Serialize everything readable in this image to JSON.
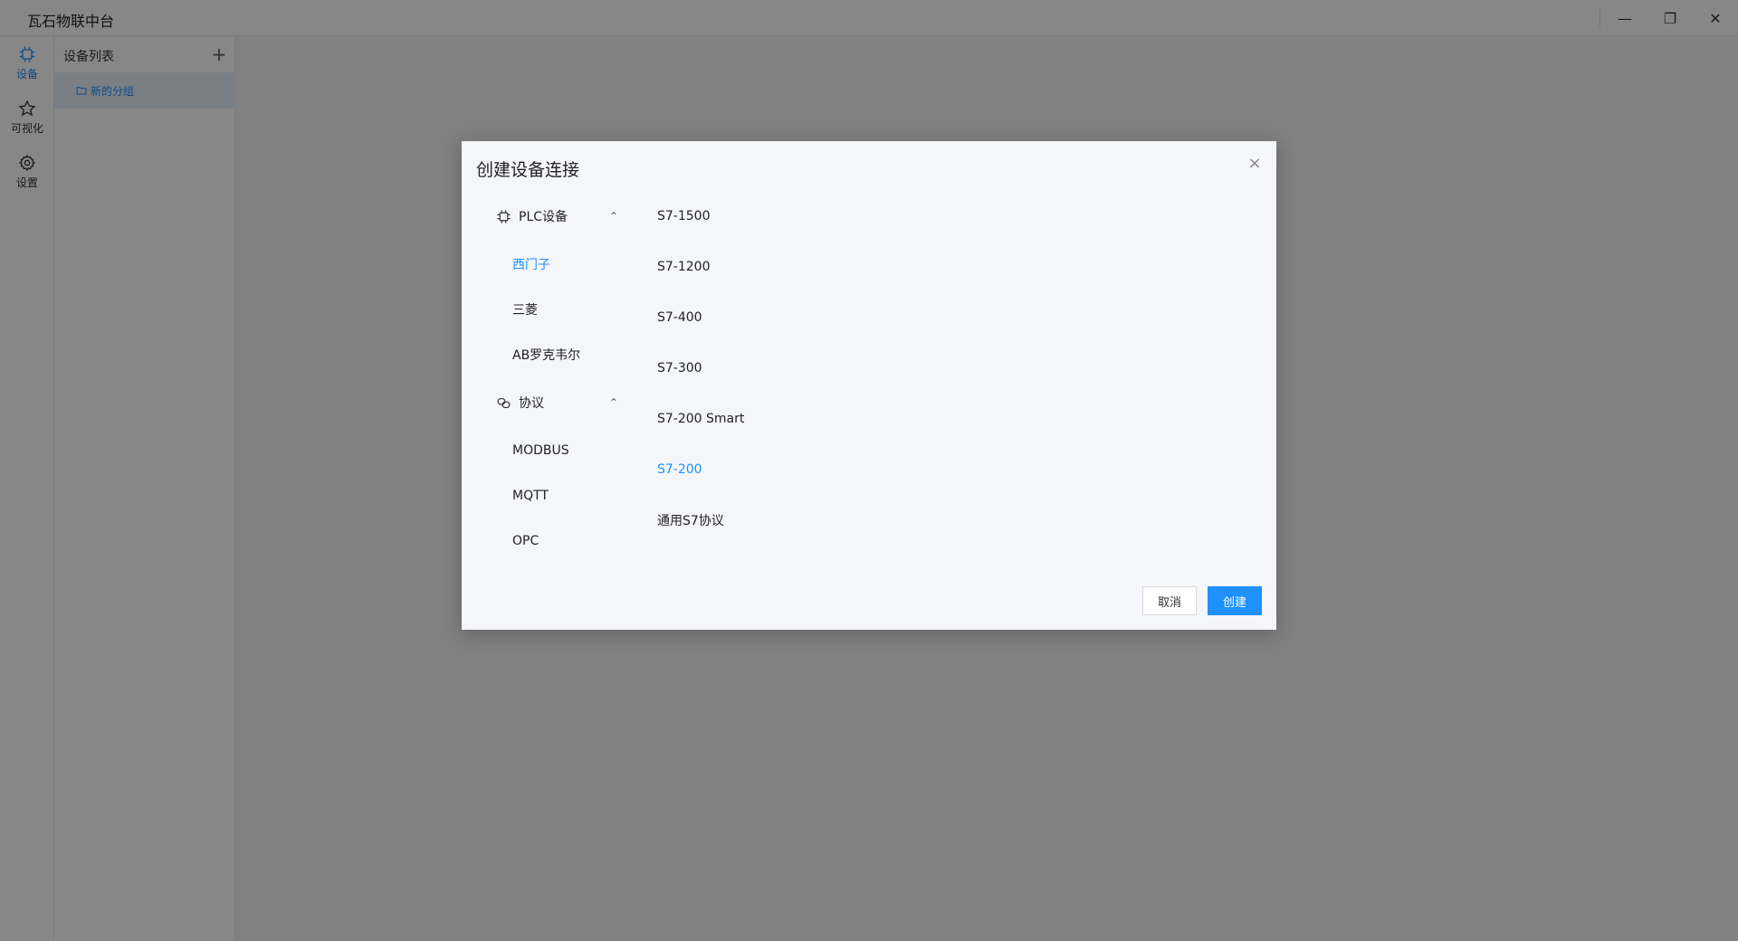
{
  "app": {
    "title": "瓦石物联中台"
  },
  "window_controls": {
    "minimize": "—",
    "maximize": "❐",
    "close": "✕"
  },
  "rail": {
    "items": [
      {
        "label": "设备",
        "icon": "chip-icon",
        "active": true
      },
      {
        "label": "可视化",
        "icon": "star-icon",
        "active": false
      },
      {
        "label": "设置",
        "icon": "gear-icon",
        "active": false
      }
    ]
  },
  "sidebar": {
    "title": "设备列表",
    "add_label": "+",
    "group": "新的分组"
  },
  "modal": {
    "title": "创建设备连接",
    "close_label": "×",
    "categories": [
      {
        "label": "PLC设备",
        "icon": "chip-icon",
        "chevron": "⌃",
        "items": [
          "西门子",
          "三菱",
          "AB罗克韦尔"
        ],
        "active_item": "西门子"
      },
      {
        "label": "协议",
        "icon": "protocol-icon",
        "chevron": "⌃",
        "items": [
          "MODBUS",
          "MQTT",
          "OPC"
        ]
      }
    ],
    "models": [
      "S7-1500",
      "S7-1200",
      "S7-400",
      "S7-300",
      "S7-200 Smart",
      "S7-200",
      "通用S7协议"
    ],
    "active_model": "S7-200",
    "cancel_label": "取消",
    "create_label": "创建"
  },
  "colors": {
    "accent": "#1e90ff",
    "overlay": "rgba(0,0,0,0.47)"
  }
}
